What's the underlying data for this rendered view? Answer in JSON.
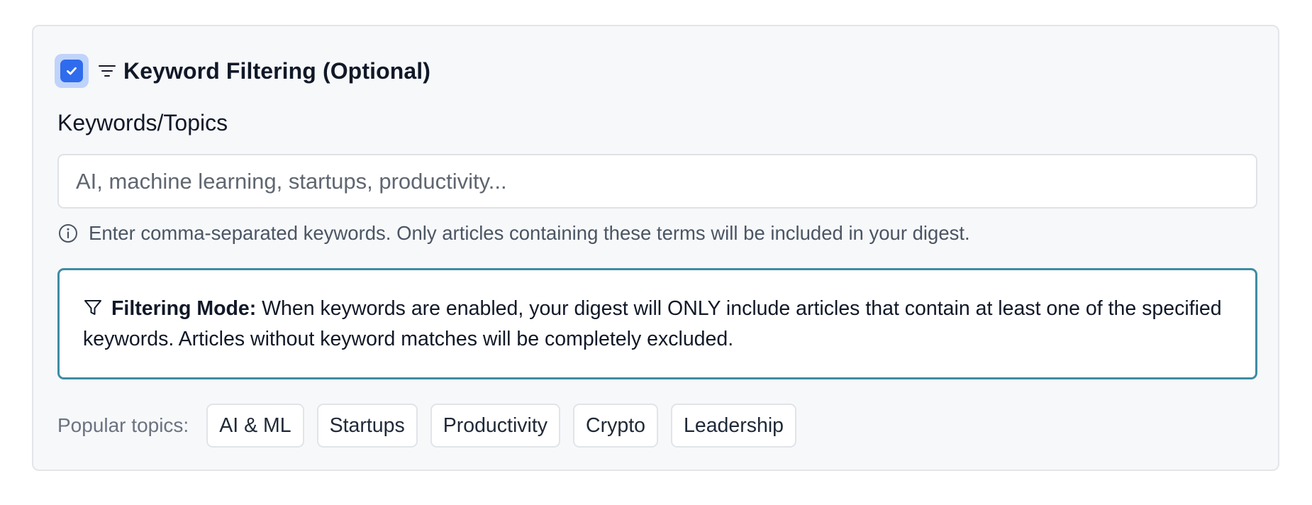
{
  "section": {
    "enabled": true,
    "title": "Keyword Filtering (Optional)",
    "checkbox_icon": "check-icon",
    "title_icon": "filter-lines-icon"
  },
  "keywords_field": {
    "label": "Keywords/Topics",
    "value": "",
    "placeholder": "AI, machine learning, startups, productivity..."
  },
  "help": {
    "icon": "info-icon",
    "text": "Enter comma-separated keywords. Only articles containing these terms will be included in your digest."
  },
  "filtering_mode": {
    "icon": "funnel-icon",
    "label": "Filtering Mode:",
    "text": "When keywords are enabled, your digest will ONLY include articles that contain at least one of the specified keywords. Articles without keyword matches will be completely excluded."
  },
  "popular_topics": {
    "label": "Popular topics:",
    "items": [
      "AI & ML",
      "Startups",
      "Productivity",
      "Crypto",
      "Leadership"
    ]
  },
  "colors": {
    "accent": "#2f6bed",
    "checkbox_ring": "#bfd3fb",
    "mode_border": "#3f8ca3",
    "panel_bg": "#f7f8fa",
    "panel_border": "#e3e5e8"
  }
}
